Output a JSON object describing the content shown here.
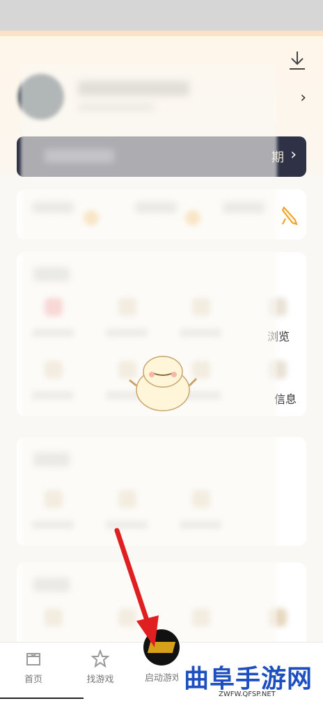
{
  "header": {
    "vip_suffix": "期",
    "download_icon": "download-icon"
  },
  "tools": {
    "partial_labels": [
      "浏览",
      "信息"
    ]
  },
  "bottom_nav": {
    "items": [
      {
        "label": "首页",
        "icon": "home-icon"
      },
      {
        "label": "找游戏",
        "icon": "star-icon"
      },
      {
        "label": "启动游戏",
        "icon": "game-avatar"
      }
    ]
  },
  "watermark": {
    "title": "曲阜手游网",
    "url": "ZWFW.QFSP.NET"
  },
  "colors": {
    "accent": "#f0a020",
    "vip_banner": "#2f3146",
    "arrow": "#e02020",
    "watermark_blue": "#1e4fbf"
  }
}
